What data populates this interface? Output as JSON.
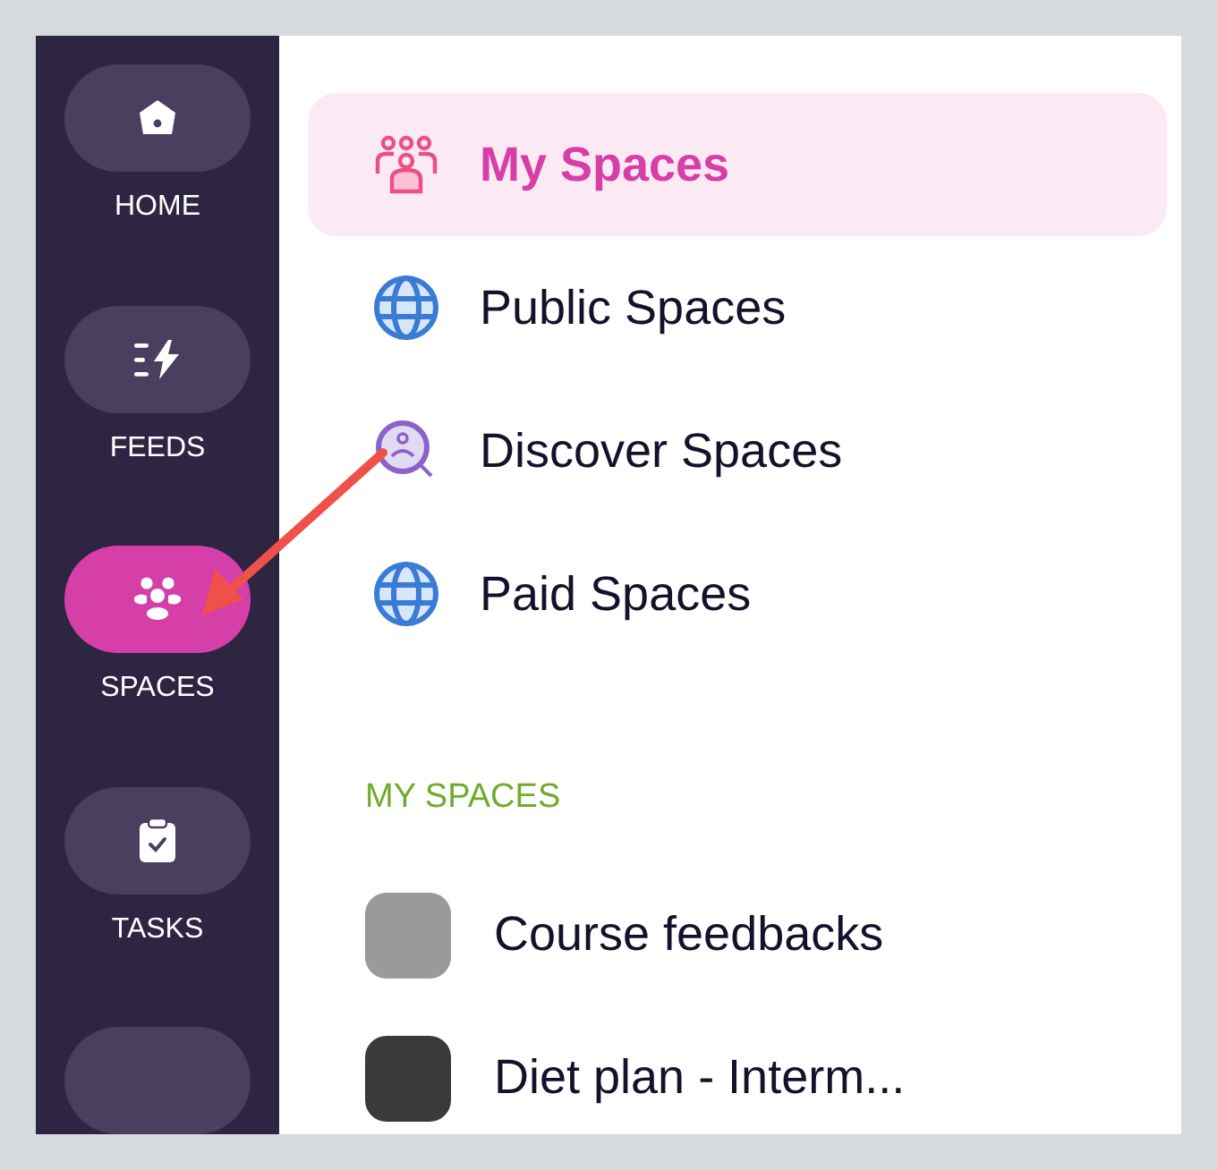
{
  "sidebar": {
    "items": [
      {
        "kind": "home",
        "label": "HOME",
        "selected": false
      },
      {
        "kind": "feeds",
        "label": "FEEDS",
        "selected": false
      },
      {
        "kind": "spaces",
        "label": "SPACES",
        "selected": true
      },
      {
        "kind": "tasks",
        "label": "TASKS",
        "selected": false
      }
    ]
  },
  "menu": {
    "items": [
      {
        "kind": "people",
        "label": "My Spaces",
        "selected": true
      },
      {
        "kind": "globe",
        "label": "Public Spaces",
        "selected": false
      },
      {
        "kind": "discover",
        "label": "Discover Spaces",
        "selected": false
      },
      {
        "kind": "globe",
        "label": "Paid Spaces",
        "selected": false
      }
    ]
  },
  "my_spaces": {
    "heading": "MY SPACES",
    "items": [
      {
        "label": "Course feedbacks"
      },
      {
        "label": "Diet plan - Interm..."
      }
    ]
  }
}
